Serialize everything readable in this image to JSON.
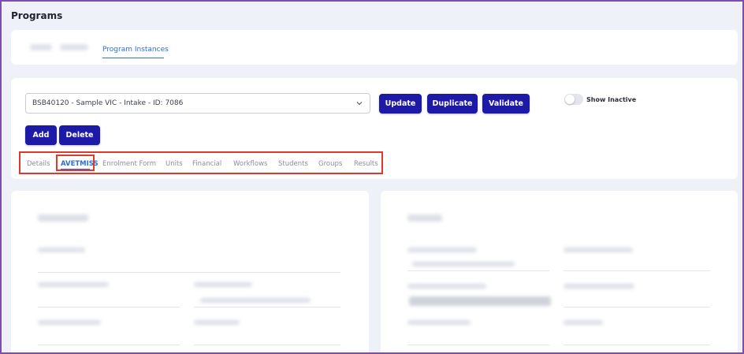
{
  "page": {
    "title": "Programs"
  },
  "top_tabs": {
    "active_label": "Program Instances"
  },
  "program_select": {
    "value": "BSB40120 - Sample VIC - Intake - ID: 7086"
  },
  "actions": {
    "update": "Update",
    "duplicate": "Duplicate",
    "validate": "Validate",
    "add": "Add",
    "delete": "Delete"
  },
  "show_inactive": {
    "label": "Show Inactive",
    "checked": false
  },
  "sub_tabs": [
    {
      "label": "Details",
      "active": false
    },
    {
      "label": "AVETMISS",
      "active": true
    },
    {
      "label": "Enrolment Form",
      "active": false
    },
    {
      "label": "Units",
      "active": false
    },
    {
      "label": "Financial",
      "active": false
    },
    {
      "label": "Workflows",
      "active": false
    },
    {
      "label": "Students",
      "active": false
    },
    {
      "label": "Groups",
      "active": false
    },
    {
      "label": "Results",
      "active": false
    }
  ],
  "colors": {
    "primary_button": "#1e1aa8",
    "active_tab": "#2c6fd6",
    "highlight": "#e0392b",
    "frame_border": "#7b4ea8"
  }
}
